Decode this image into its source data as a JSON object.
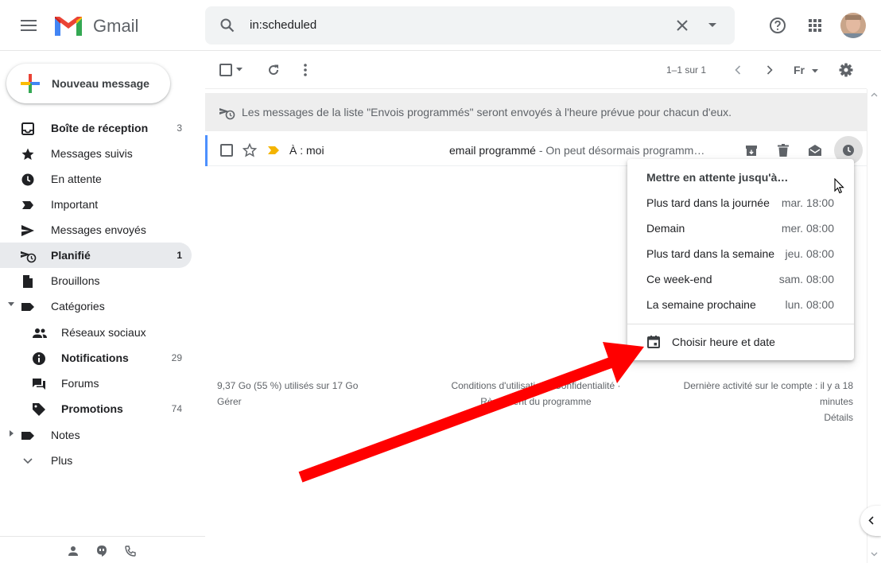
{
  "app": {
    "name": "Gmail"
  },
  "search": {
    "query": "in:scheduled"
  },
  "sidebar": {
    "compose_label": "Nouveau message",
    "items": [
      {
        "label": "Boîte de réception",
        "count": "3",
        "bold": true
      },
      {
        "label": "Messages suivis",
        "count": ""
      },
      {
        "label": "En attente",
        "count": ""
      },
      {
        "label": "Important",
        "count": ""
      },
      {
        "label": "Messages envoyés",
        "count": ""
      },
      {
        "label": "Planifié",
        "count": "1",
        "bold": true,
        "active": true
      },
      {
        "label": "Brouillons",
        "count": ""
      },
      {
        "label": "Catégories",
        "count": ""
      },
      {
        "label": "Réseaux sociaux",
        "count": ""
      },
      {
        "label": "Notifications",
        "count": "29",
        "bold": true
      },
      {
        "label": "Forums",
        "count": ""
      },
      {
        "label": "Promotions",
        "count": "74",
        "bold": true
      },
      {
        "label": "Notes",
        "count": ""
      },
      {
        "label": "Plus",
        "count": ""
      }
    ]
  },
  "toolbar": {
    "pagination": "1–1 sur 1",
    "language": "Fr"
  },
  "banner": {
    "text": "Les messages de la liste \"Envois programmés\" seront envoyés à l'heure prévue pour chacun d'eux."
  },
  "message": {
    "recipient": "À : moi",
    "subject": "email programmé",
    "snippet": " - On peut désormais programm…"
  },
  "footer": {
    "storage": "9,37 Go (55 %) utilisés sur 17 Go",
    "manage": "Gérer",
    "terms_line1": "Conditions d'utilisation · Confidentialité ·",
    "terms_line2": "Règlement du programme",
    "activity_line1": "Dernière activité sur le compte : il y a 18",
    "activity_line2": "minutes",
    "details": "Détails"
  },
  "snooze_menu": {
    "title": "Mettre en attente jusqu'à…",
    "options": [
      {
        "label": "Plus tard dans la journée",
        "value": "mar. 18:00"
      },
      {
        "label": "Demain",
        "value": "mer. 08:00"
      },
      {
        "label": "Plus tard dans la semaine",
        "value": "jeu. 08:00"
      },
      {
        "label": "Ce week-end",
        "value": "sam. 08:00"
      },
      {
        "label": "La semaine prochaine",
        "value": "lun. 08:00"
      }
    ],
    "custom_label": "Choisir heure et date"
  },
  "colors": {
    "accent_blue": "#4d90fe",
    "active_nav": "#e8eaed",
    "arrow_red": "#ff0000",
    "important_yellow": "#f4b400"
  }
}
